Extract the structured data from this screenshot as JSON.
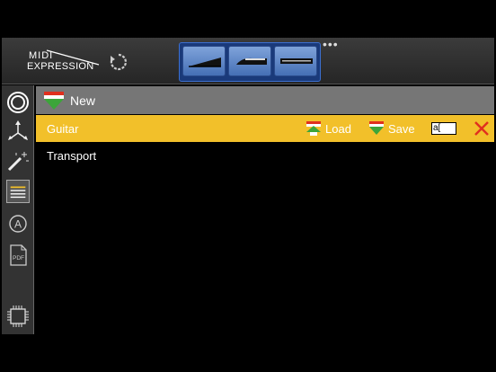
{
  "header": {
    "logo_line1": "MIDI",
    "logo_line2": "EXPRESSION",
    "more_label": "•••",
    "pedals": [
      "pedal-expression-icon",
      "pedal-slider-icon",
      "pedal-bar-icon"
    ]
  },
  "sidebar": {
    "items": [
      "record-icon",
      "arrows-icon",
      "wand-icon",
      "list-icon",
      "a-circle-icon",
      "pdf-icon",
      "chip-icon"
    ],
    "active": "list-icon"
  },
  "toolbar": {
    "new_label": "New"
  },
  "list": {
    "rows": [
      {
        "label": "Guitar",
        "selected": true
      },
      {
        "label": "Transport",
        "selected": false
      }
    ],
    "load_label": "Load",
    "save_label": "Save",
    "name_field_value": "a["
  },
  "colors": {
    "selected_row": "#f2c02a",
    "toolbar": "#767676",
    "delete": "#e0301e"
  }
}
